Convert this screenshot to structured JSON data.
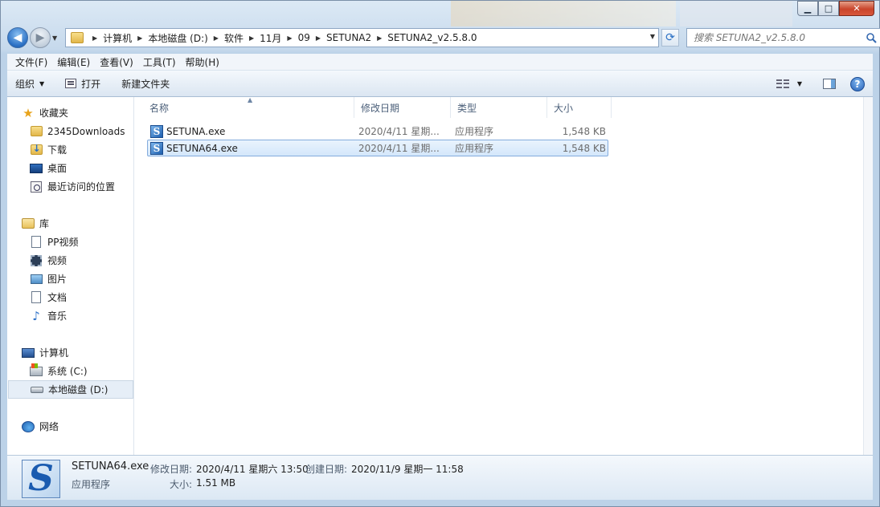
{
  "window": {
    "caption_min": "▁",
    "caption_max": "□",
    "caption_close": "✕"
  },
  "address": {
    "crumbs": [
      "计算机",
      "本地磁盘 (D:)",
      "软件",
      "11月",
      "09",
      "SETUNA2",
      "SETUNA2_v2.5.8.0"
    ]
  },
  "search": {
    "placeholder": "搜索 SETUNA2_v2.5.8.0"
  },
  "menu": {
    "file": "文件(F)",
    "edit": "编辑(E)",
    "view": "查看(V)",
    "tools": "工具(T)",
    "help": "帮助(H)"
  },
  "commands": {
    "organize": "组织",
    "open": "打开",
    "new_folder": "新建文件夹"
  },
  "nav": {
    "favorites": "收藏夹",
    "fav_items": [
      "2345Downloads",
      "下载",
      "桌面",
      "最近访问的位置"
    ],
    "libraries": "库",
    "lib_items": [
      "PP视频",
      "视频",
      "图片",
      "文档",
      "音乐"
    ],
    "computer": "计算机",
    "comp_items": [
      "系统 (C:)",
      "本地磁盘 (D:)"
    ],
    "network": "网络"
  },
  "columns": {
    "name": "名称",
    "date": "修改日期",
    "type": "类型",
    "size": "大小"
  },
  "files": [
    {
      "name": "SETUNA.exe",
      "date": "2020/4/11 星期...",
      "type": "应用程序",
      "size": "1,548 KB"
    },
    {
      "name": "SETUNA64.exe",
      "date": "2020/4/11 星期...",
      "type": "应用程序",
      "size": "1,548 KB"
    }
  ],
  "details": {
    "name": "SETUNA64.exe",
    "type": "应用程序",
    "modified_label": "修改日期:",
    "modified_value": "2020/4/11 星期六 13:50",
    "created_label": "创建日期:",
    "created_value": "2020/11/9 星期一 11:58",
    "size_label": "大小:",
    "size_value": "1.51 MB"
  },
  "colors": {
    "accent": "#2a6fc4",
    "selection": "#d4e7fb"
  }
}
